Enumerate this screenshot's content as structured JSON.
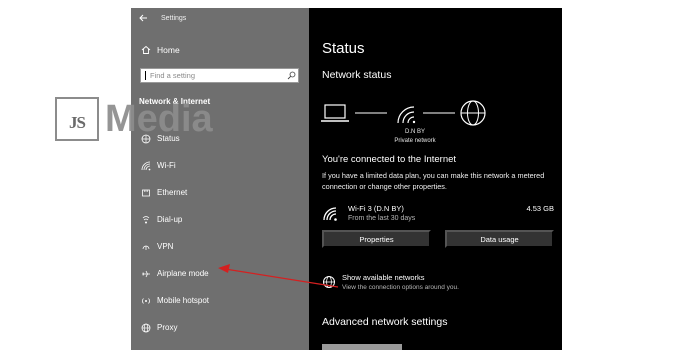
{
  "window": {
    "title": "Settings"
  },
  "sidebar": {
    "home_label": "Home",
    "search_placeholder": "Find a setting",
    "section_title": "Network & Internet",
    "items": [
      {
        "label": "Status",
        "icon": "home-globe-icon"
      },
      {
        "label": "Wi-Fi",
        "icon": "wifi-icon"
      },
      {
        "label": "Ethernet",
        "icon": "ethernet-icon"
      },
      {
        "label": "Dial-up",
        "icon": "dialup-icon"
      },
      {
        "label": "VPN",
        "icon": "vpn-icon"
      },
      {
        "label": "Airplane mode",
        "icon": "airplane-icon"
      },
      {
        "label": "Mobile hotspot",
        "icon": "hotspot-icon"
      },
      {
        "label": "Proxy",
        "icon": "globe-icon"
      }
    ]
  },
  "main": {
    "title": "Status",
    "network_status_heading": "Network status",
    "network_name": "D.N BY",
    "network_type": "Private network",
    "connected_heading": "You're connected to the Internet",
    "connected_description": "If you have a limited data plan, you can make this network a metered connection or change other properties.",
    "wifi": {
      "name": "Wi-Fi 3 (D.N BY)",
      "period": "From the last 30 days",
      "usage": "4.53 GB"
    },
    "buttons": {
      "properties": "Properties",
      "data_usage": "Data usage"
    },
    "show_networks": {
      "title": "Show available networks",
      "subtitle": "View the connection options around you."
    },
    "advanced_heading": "Advanced network settings"
  },
  "watermark": {
    "box_text": "JS",
    "text": "Media"
  },
  "annotation": {
    "arrow_color": "#d42020"
  },
  "colors": {
    "sidebar_bg": "#6f6f6f",
    "main_bg": "#000000",
    "button_bg": "#333333"
  }
}
